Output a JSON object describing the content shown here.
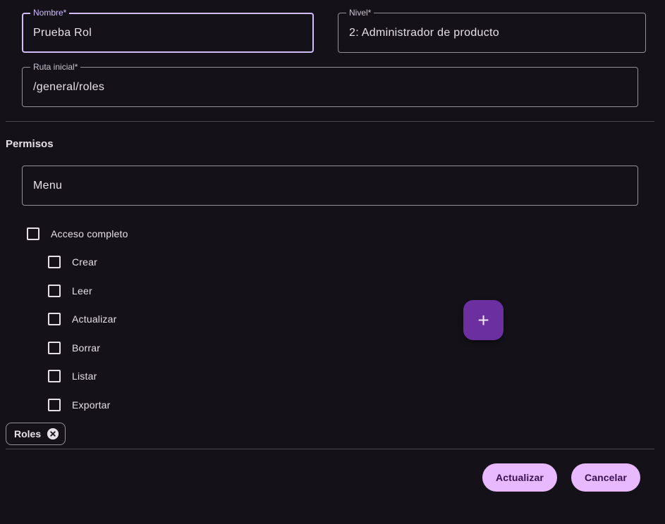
{
  "form": {
    "nombre": {
      "label": "Nombre*",
      "value": "Prueba Rol"
    },
    "nivel": {
      "label": "Nivel*",
      "value": "2: Administrador de producto"
    },
    "ruta": {
      "label": "Ruta inicial*",
      "value": "/general/roles"
    }
  },
  "permisos": {
    "title": "Permisos",
    "menu_value": "Menu",
    "full_access_label": "Acceso completo",
    "options": [
      "Crear",
      "Leer",
      "Actualizar",
      "Borrar",
      "Listar",
      "Exportar"
    ],
    "chip_label": "Roles"
  },
  "fab": {
    "icon": "plus-icon",
    "glyph": "+"
  },
  "actions": {
    "update_label": "Actualizar",
    "cancel_label": "Cancelar"
  },
  "colors": {
    "background": "#141218",
    "accent": "#d0bcff",
    "fab": "#6b2fa0",
    "button": "#e8b9ff"
  }
}
